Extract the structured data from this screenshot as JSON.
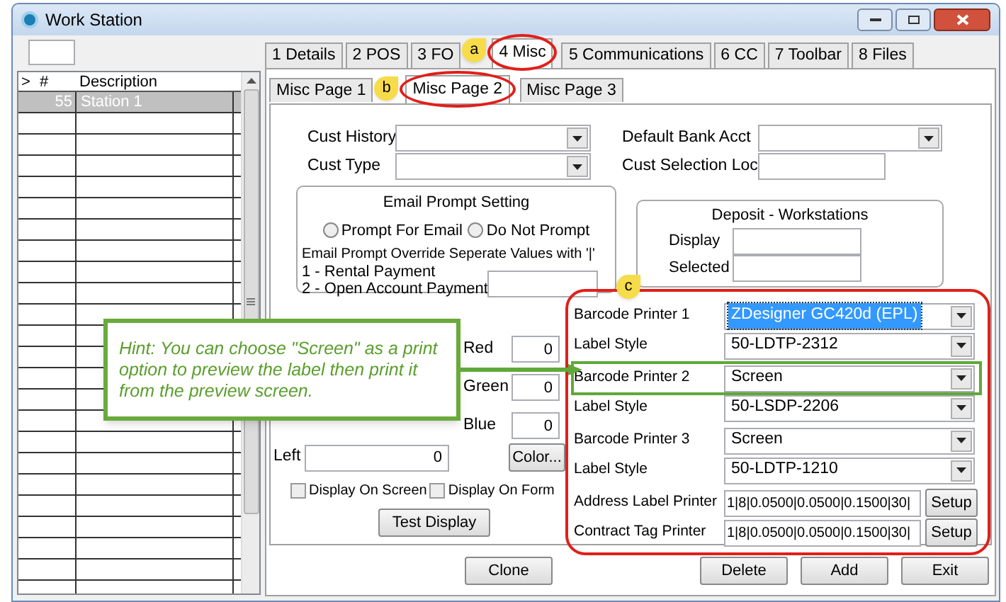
{
  "window": {
    "title": "Work Station"
  },
  "list": {
    "columns": [
      ">",
      "#",
      "Description"
    ],
    "rows": [
      {
        "number": "55",
        "description": "Station 1",
        "selected": true
      }
    ]
  },
  "tabs": [
    {
      "label": "1 Details",
      "selected": false,
      "circled": false
    },
    {
      "label": "2 POS",
      "selected": false,
      "circled": false
    },
    {
      "label": "3 FO",
      "selected": false,
      "circled": false
    },
    {
      "label": "4 Misc",
      "selected": true,
      "circled": true,
      "callout": "a"
    },
    {
      "label": "5 Communications",
      "selected": false,
      "circled": false
    },
    {
      "label": "6 CC",
      "selected": false,
      "circled": false
    },
    {
      "label": "7 Toolbar",
      "selected": false,
      "circled": false
    },
    {
      "label": "8 Files",
      "selected": false,
      "circled": false
    }
  ],
  "subtabs": [
    {
      "label": "Misc Page 1",
      "selected": false,
      "circled": false
    },
    {
      "label": "Misc Page 2",
      "selected": true,
      "circled": true,
      "callout": "b"
    },
    {
      "label": "Misc Page 3",
      "selected": false,
      "circled": false
    }
  ],
  "top_fields": [
    {
      "kind": "dropdown",
      "label": "Cust History"
    },
    {
      "kind": "dropdown",
      "label": "Default Bank Acct"
    },
    {
      "kind": "dropdown",
      "label": "Cust Type"
    },
    {
      "kind": "text",
      "label": "Cust Selection Loc"
    }
  ],
  "email_prompt": {
    "title": "Email Prompt Setting",
    "options": [
      {
        "label": "Prompt For Email",
        "selected": false
      },
      {
        "label": "Do Not Prompt",
        "selected": false
      }
    ],
    "override": "Email Prompt Override Seperate Values with '|'",
    "lines": [
      "1 - Rental Payment",
      "2 - Open Account Payment"
    ]
  },
  "deposit": {
    "title": "Deposit - Workstations",
    "fields": [
      {
        "label": "Display"
      },
      {
        "label": "Selected"
      }
    ]
  },
  "color_fields": [
    {
      "label": "Red",
      "value": "0"
    },
    {
      "label": "Green",
      "value": "0"
    },
    {
      "label": "Blue",
      "value": "0"
    }
  ],
  "left_field": {
    "label": "Left",
    "value": "0"
  },
  "color_button": "Color...",
  "checkboxes": [
    {
      "label": "Display On Screen",
      "checked": false
    },
    {
      "label": "Display On Form",
      "checked": false
    }
  ],
  "test_button": "Test Display",
  "printer_group": {
    "callout": "c",
    "rows": [
      {
        "kind": "dropdown",
        "label": "Barcode Printer 1",
        "value": "ZDesigner GC420d (EPL)",
        "selected": true,
        "highlighted": false
      },
      {
        "kind": "dropdown",
        "label": "Label Style",
        "value": "50-LDTP-2312",
        "selected": false,
        "highlighted": false
      },
      {
        "kind": "dropdown",
        "label": "Barcode Printer 2",
        "value": "Screen",
        "selected": false,
        "highlighted": true
      },
      {
        "kind": "dropdown",
        "label": "Label Style",
        "value": "50-LSDP-2206",
        "selected": false,
        "highlighted": false
      },
      {
        "kind": "dropdown",
        "label": "Barcode Printer 3",
        "value": "Screen",
        "selected": false,
        "highlighted": false
      },
      {
        "kind": "dropdown",
        "label": "Label Style",
        "value": "50-LDTP-1210",
        "selected": false,
        "highlighted": false
      },
      {
        "kind": "setup",
        "label": "Address Label Printer",
        "value": "1|8|0.0500|0.0500|0.1500|30|",
        "button": "Setup"
      },
      {
        "kind": "setup",
        "label": "Contract Tag Printer",
        "value": "1|8|0.0500|0.0500|0.1500|30|",
        "button": "Setup"
      }
    ]
  },
  "hint": {
    "text": "Hint: You can choose \"Screen\" as a print option to preview the label then print it from the preview screen."
  },
  "footer": {
    "left": [
      "Clone"
    ],
    "right": [
      "Delete",
      "Add",
      "Exit"
    ]
  }
}
